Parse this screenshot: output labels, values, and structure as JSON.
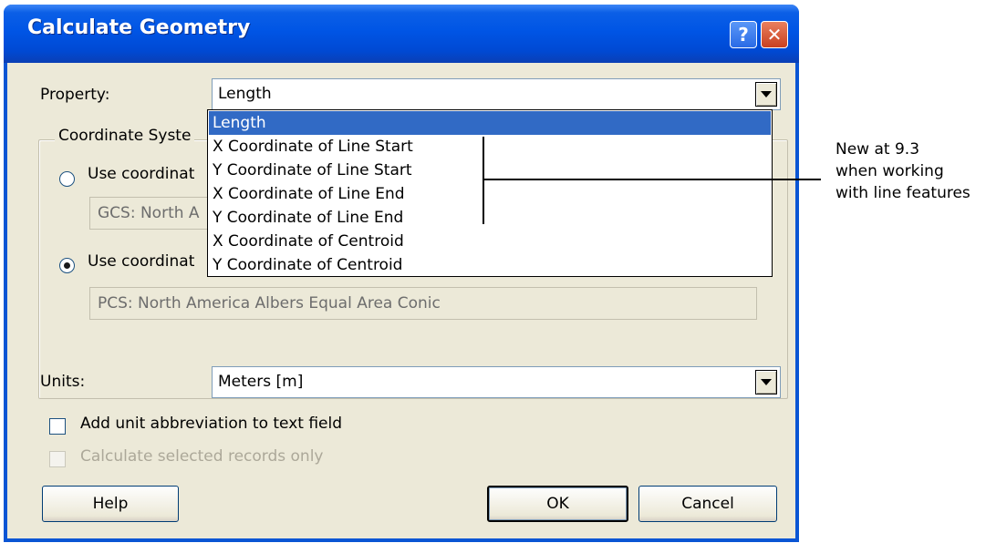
{
  "window": {
    "title": "Calculate Geometry",
    "help_glyph": "?",
    "close_glyph": "✕"
  },
  "property": {
    "label": "Property:",
    "value": "Length",
    "options": [
      "Length",
      "X Coordinate of Line Start",
      "Y Coordinate of Line Start",
      "X Coordinate of Line End",
      "Y Coordinate of Line End",
      "X Coordinate of Centroid",
      "Y Coordinate of Centroid"
    ],
    "selected_index": 0
  },
  "coordinate_system": {
    "group_label": "Coordinate Syste",
    "option1_label": "Use coordinat",
    "option1_value": "GCS: North A",
    "option2_label": "Use coordinat",
    "option2_value": "PCS: North America Albers Equal Area Conic",
    "selected_option": 2
  },
  "units": {
    "label": "Units:",
    "value": "Meters [m]"
  },
  "checkboxes": {
    "add_abbrev": "Add unit abbreviation to text field",
    "selected_only": "Calculate selected records only"
  },
  "buttons": {
    "help": "Help",
    "ok": "OK",
    "cancel": "Cancel"
  },
  "annotation": {
    "line1": "New at 9.3",
    "line2": "when working",
    "line3": "with line features"
  },
  "colors": {
    "title_bar": "#0055e5",
    "selection": "#316ac5",
    "dialog_bg": "#ece9d8"
  }
}
